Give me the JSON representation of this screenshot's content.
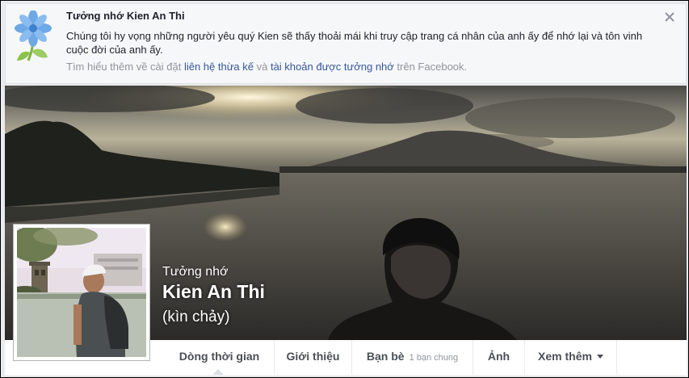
{
  "banner": {
    "title": "Tưởng nhớ Kien An Thi",
    "message": "Chúng tôi hy vọng những người yêu quý Kien sẽ thấy thoải mái khi truy cập trang cá nhân của anh ấy để nhớ lại và tôn vinh cuộc đời của anh ấy.",
    "learn_prefix": "Tìm hiểu thêm về cài đặt ",
    "link_legacy_contact": "liên hệ thừa kế",
    "learn_and": " và ",
    "link_memorialized_account": "tài khoản được tưởng nhớ",
    "learn_suffix": " trên Facebook."
  },
  "profile": {
    "memorial_label": "Tưởng nhớ",
    "name": "Kien An Thi",
    "alternate_name": "(kìn chảy)"
  },
  "nav": {
    "timeline": "Dòng thời gian",
    "about": "Giới thiệu",
    "friends": "Bạn bè",
    "mutual_friends": "1 bạn chung",
    "photos": "Ảnh",
    "more": "Xem thêm"
  },
  "icons": {
    "banner": "flower-icon",
    "close": "close-icon",
    "dropdown": "caret-down-icon"
  },
  "colors": {
    "link": "#365899",
    "muted": "#90949c",
    "text": "#1d2129"
  }
}
